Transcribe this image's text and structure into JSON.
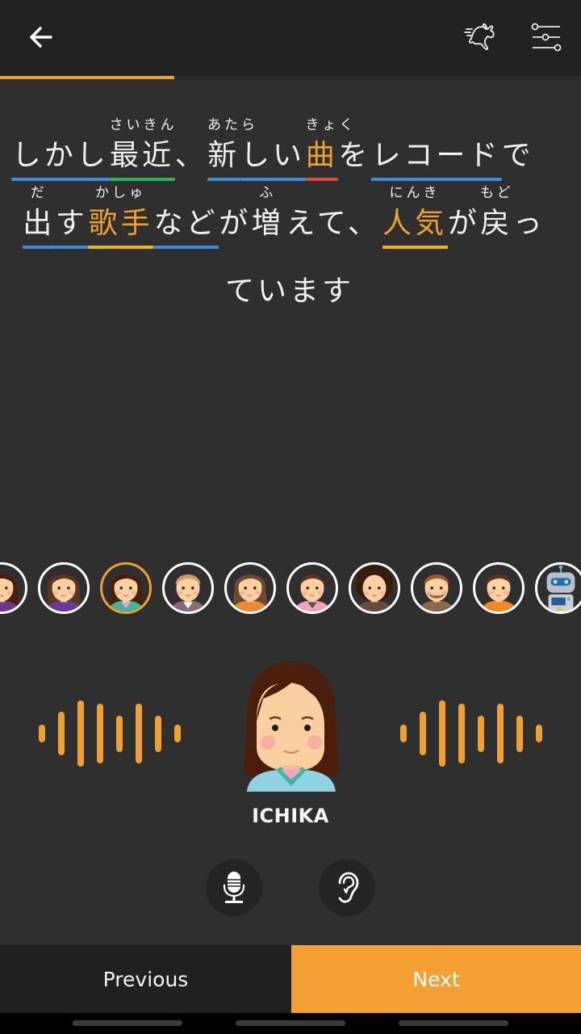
{
  "header": {
    "back_icon": "arrow-left-icon",
    "speed_icon": "running-rabbit-icon",
    "settings_icon": "sliders-icon",
    "progress_fraction": 0.3,
    "accent_color": "#f0a030"
  },
  "sentence": {
    "lines": [
      [
        {
          "base": "しかし",
          "ruby": "",
          "underline": "#3a8fd8",
          "color": "default"
        },
        {
          "base": "最近",
          "ruby": "さいきん",
          "underline": "#2db35a",
          "color": "default"
        },
        {
          "base": "、",
          "ruby": "",
          "underline": "",
          "color": "default"
        },
        {
          "base": "新",
          "ruby": "あたら",
          "underline": "#3a8fd8",
          "color": "default"
        },
        {
          "base": "しい",
          "ruby": "",
          "underline": "#3a8fd8",
          "color": "default"
        },
        {
          "base": "曲",
          "ruby": "きょく",
          "underline": "#e04a3a",
          "color": "orange"
        },
        {
          "base": "を",
          "ruby": "",
          "underline": "",
          "color": "default"
        },
        {
          "base": "レコード",
          "ruby": "",
          "underline": "#3a8fd8",
          "color": "default"
        },
        {
          "base": "で",
          "ruby": "",
          "underline": "",
          "color": "default"
        }
      ],
      [
        {
          "base": "出",
          "ruby": "だ",
          "underline": "#3a8fd8",
          "color": "default"
        },
        {
          "base": "す",
          "ruby": "",
          "underline": "#3a8fd8",
          "color": "default"
        },
        {
          "base": "歌手",
          "ruby": "かしゅ",
          "underline": "#f0b820",
          "color": "orange"
        },
        {
          "base": "など",
          "ruby": "",
          "underline": "#3a8fd8",
          "color": "default"
        },
        {
          "base": "が",
          "ruby": "",
          "underline": "",
          "color": "default"
        },
        {
          "base": "増",
          "ruby": "ふ",
          "underline": "",
          "color": "default"
        },
        {
          "base": "えて、",
          "ruby": "",
          "underline": "",
          "color": "default"
        },
        {
          "base": "人気",
          "ruby": "にんき",
          "underline": "#f0b820",
          "color": "orange"
        },
        {
          "base": "が",
          "ruby": "",
          "underline": "",
          "color": "default"
        },
        {
          "base": "戻",
          "ruby": "もど",
          "underline": "",
          "color": "default"
        },
        {
          "base": "っ",
          "ruby": "",
          "underline": "",
          "color": "default"
        }
      ],
      [
        {
          "base": "ています",
          "ruby": "",
          "underline": "",
          "color": "default"
        }
      ]
    ]
  },
  "voices": {
    "selected_index": 2,
    "items": [
      {
        "name": "voice-partial",
        "icon": "avatar-woman-dark-hair-icon"
      },
      {
        "name": "voice-woman-purple",
        "icon": "avatar-woman-brown-hair-purple-shirt-icon"
      },
      {
        "name": "voice-ichika",
        "icon": "avatar-woman-long-hair-teal-jacket-icon"
      },
      {
        "name": "voice-blonde",
        "icon": "avatar-blonde-grey-jacket-icon"
      },
      {
        "name": "voice-woman-orange",
        "icon": "avatar-woman-bangs-orange-shirt-icon"
      },
      {
        "name": "voice-man-pink",
        "icon": "avatar-man-pink-shirt-icon"
      },
      {
        "name": "voice-man-afro",
        "icon": "avatar-man-afro-icon"
      },
      {
        "name": "voice-man-beard",
        "icon": "avatar-man-beard-icon"
      },
      {
        "name": "voice-boy-orange",
        "icon": "avatar-boy-orange-shirt-icon"
      },
      {
        "name": "voice-robot",
        "icon": "avatar-robot-icon"
      }
    ]
  },
  "speaker": {
    "name": "ICHIKA",
    "avatar_icon": "avatar-woman-long-hair-teal-jacket-icon",
    "wave_icon": "sound-wave-icon"
  },
  "controls": {
    "record_icon": "microphone-icon",
    "listen_icon": "ear-icon"
  },
  "footer": {
    "previous_label": "Previous",
    "next_label": "Next",
    "next_color": "#f4a034"
  }
}
